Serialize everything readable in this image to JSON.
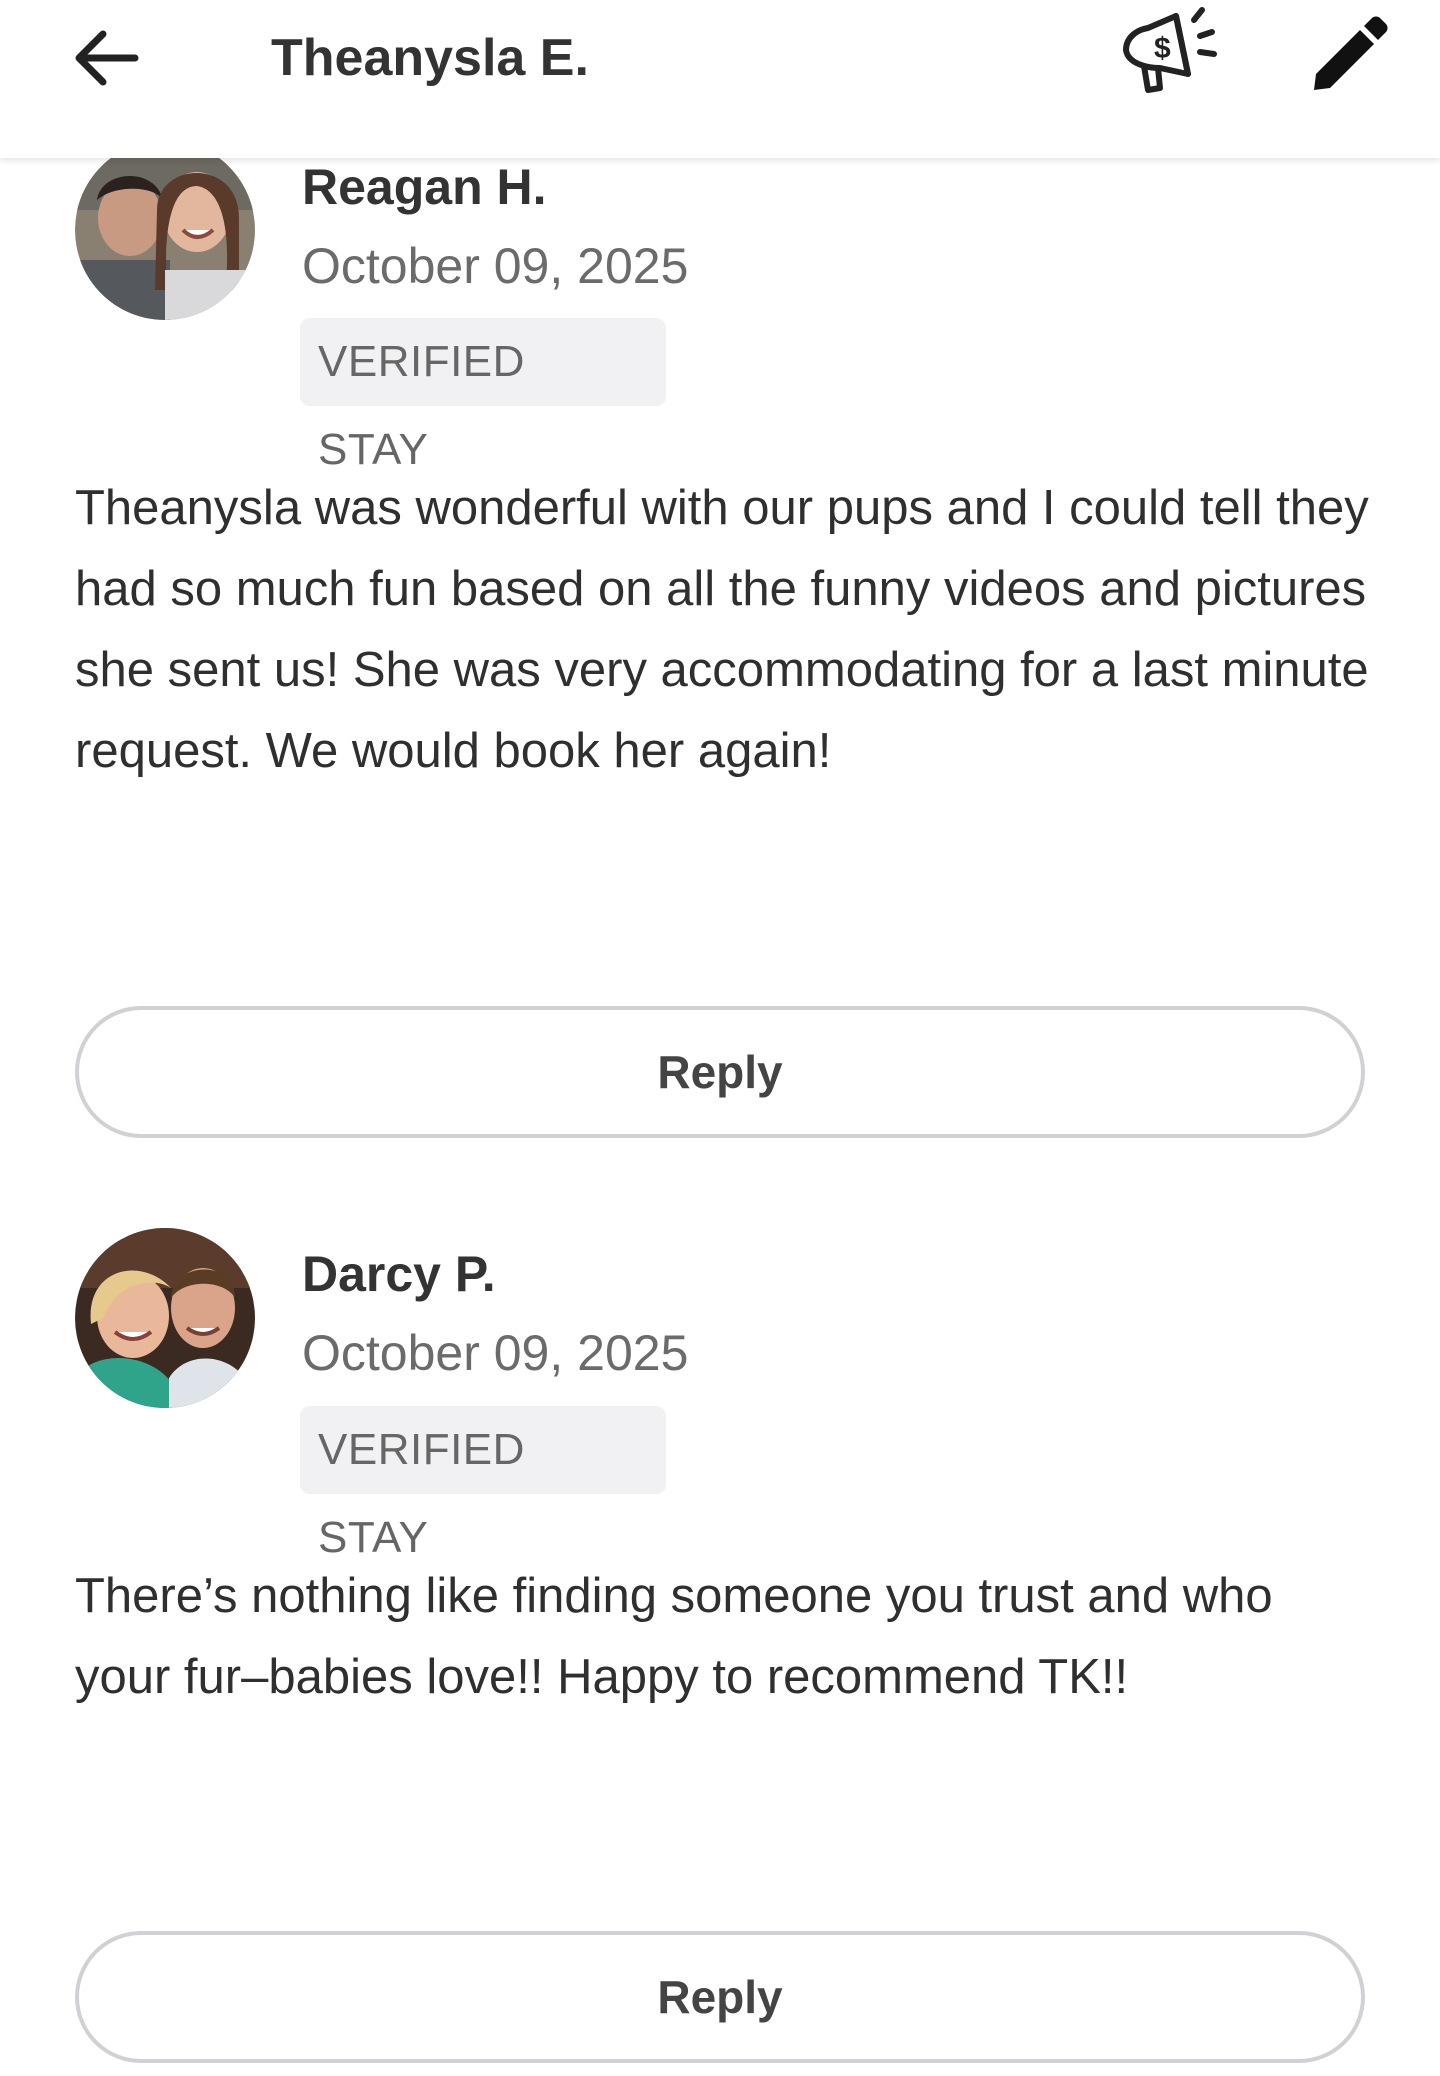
{
  "header": {
    "title": "Theanysla E.",
    "back_icon": "arrow-left-icon",
    "promo_icon": "megaphone-dollar-icon",
    "edit_icon": "pencil-icon"
  },
  "reviews": [
    {
      "name": "Reagan H.",
      "date": "October 09, 2025",
      "badge": "VERIFIED STAY",
      "text": "Theanysla was wonderful with our pups and I could tell they had so much fun based on all the funny videos and pictures she sent us! She was very accommodating for a last minute request. We would book her again!",
      "reply_label": "Reply"
    },
    {
      "name": "Darcy P.",
      "date": "October 09, 2025",
      "badge": "VERIFIED STAY",
      "text": "There’s nothing like finding someone you trust and who your fur–babies love!! Happy to recommend TK!!",
      "reply_label": "Reply"
    }
  ],
  "colors": {
    "text": "#2f2f2f",
    "muted": "#6b6b6b",
    "badge_bg": "#f1f1f3",
    "button_border": "#cfd1d4"
  }
}
